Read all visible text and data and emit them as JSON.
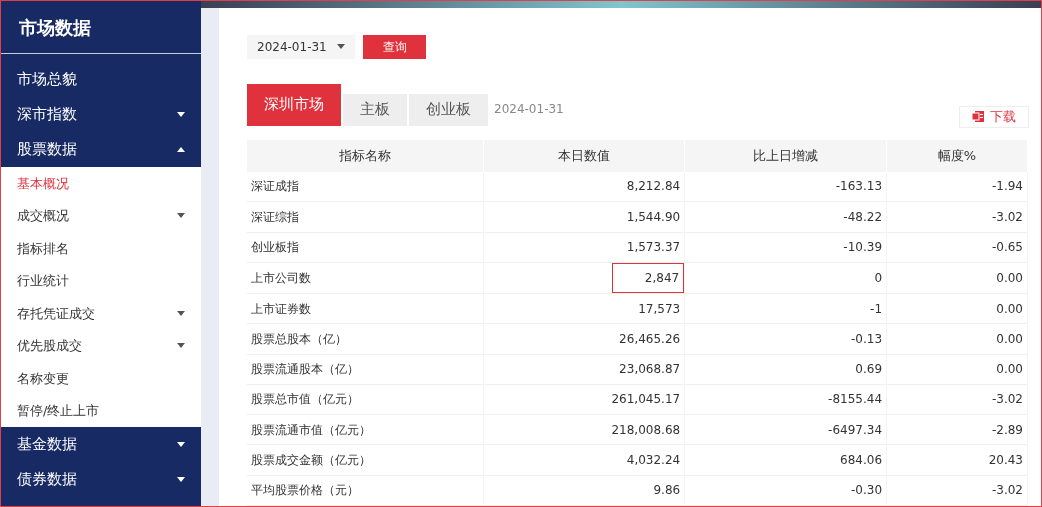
{
  "sidebar": {
    "title": "市场数据",
    "items": [
      {
        "label": "市场总貌",
        "kind": "section",
        "selected": false
      },
      {
        "label": "深市指数",
        "kind": "section",
        "selected": false,
        "expanded": false
      },
      {
        "label": "股票数据",
        "kind": "section",
        "selected": false,
        "expanded": true
      },
      {
        "label": "基本概况",
        "kind": "sub",
        "selected": true
      },
      {
        "label": "成交概况",
        "kind": "sub",
        "selected": false,
        "expanded": false
      },
      {
        "label": "指标排名",
        "kind": "sub",
        "selected": false
      },
      {
        "label": "行业统计",
        "kind": "sub",
        "selected": false
      },
      {
        "label": "存托凭证成交",
        "kind": "sub",
        "selected": false,
        "expanded": false
      },
      {
        "label": "优先股成交",
        "kind": "sub",
        "selected": false,
        "expanded": false
      },
      {
        "label": "名称变更",
        "kind": "sub",
        "selected": false
      },
      {
        "label": "暂停/终止上市",
        "kind": "sub",
        "selected": false
      },
      {
        "label": "基金数据",
        "kind": "section",
        "selected": false,
        "expanded": false
      },
      {
        "label": "债券数据",
        "kind": "section",
        "selected": false,
        "expanded": false
      }
    ]
  },
  "query": {
    "date": "2024-01-31",
    "button": "查询"
  },
  "tabs": [
    {
      "label": "深圳市场",
      "selected": true
    },
    {
      "label": "主板",
      "selected": false
    },
    {
      "label": "创业板",
      "selected": false
    }
  ],
  "data_date": "2024-01-31",
  "download_button": "下载",
  "table": {
    "columns": [
      "指标名称",
      "本日数值",
      "比上日增减",
      "幅度%"
    ],
    "rows": [
      {
        "cells": [
          "深证成指",
          "8,212.84",
          "-163.13",
          "-1.94"
        ],
        "highlighted": false
      },
      {
        "cells": [
          "深证综指",
          "1,544.90",
          "-48.22",
          "-3.02"
        ],
        "highlighted": false
      },
      {
        "cells": [
          "创业板指",
          "1,573.37",
          "-10.39",
          "-0.65"
        ],
        "highlighted": false
      },
      {
        "cells": [
          "上市公司数",
          "2,847",
          "0",
          "0.00"
        ],
        "highlighted": true
      },
      {
        "cells": [
          "上市证券数",
          "17,573",
          "-1",
          "0.00"
        ],
        "highlighted": false
      },
      {
        "cells": [
          "股票总股本（亿）",
          "26,465.26",
          "-0.13",
          "0.00"
        ],
        "highlighted": false
      },
      {
        "cells": [
          "股票流通股本（亿）",
          "23,068.87",
          "0.69",
          "0.00"
        ],
        "highlighted": false
      },
      {
        "cells": [
          "股票总市值（亿元）",
          "261,045.17",
          "-8155.44",
          "-3.02"
        ],
        "highlighted": false
      },
      {
        "cells": [
          "股票流通市值（亿元）",
          "218,008.68",
          "-6497.34",
          "-2.89"
        ],
        "highlighted": false
      },
      {
        "cells": [
          "股票成交金额（亿元）",
          "4,032.24",
          "684.06",
          "20.43"
        ],
        "highlighted": false
      },
      {
        "cells": [
          "平均股票价格（元）",
          "9.86",
          "-0.30",
          "-3.02"
        ],
        "highlighted": false
      }
    ]
  }
}
